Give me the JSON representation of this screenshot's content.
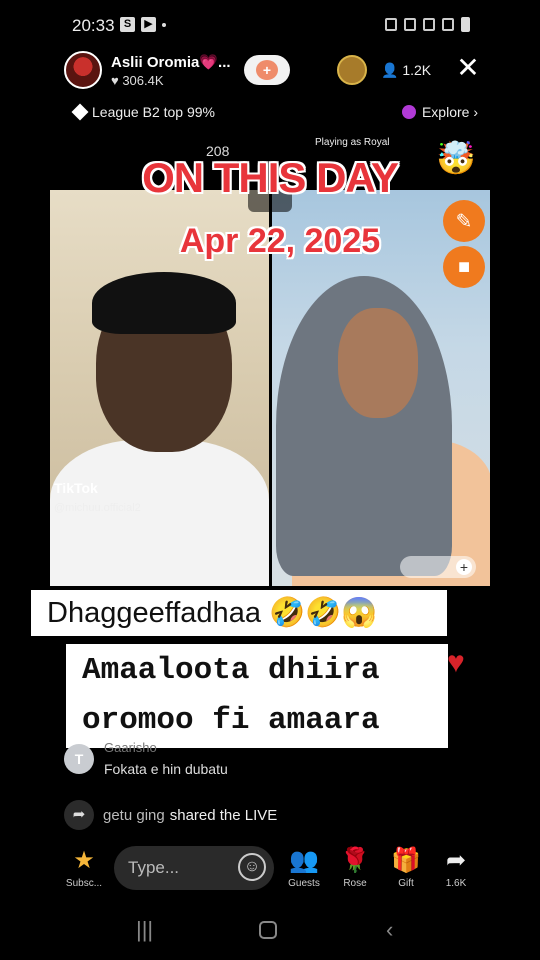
{
  "status_bar": {
    "time": "20:33",
    "s_badge": "S"
  },
  "live_header": {
    "host_name": "Aslii Oromia💗...",
    "host_likes": "♥ 306.4K",
    "follow_symbol": "+",
    "viewer_count": "👤 1.2K",
    "close_symbol": "✕"
  },
  "league": {
    "label": "League B2 top 99%"
  },
  "explore": {
    "label": "Explore ›"
  },
  "battle": {
    "score": "208",
    "playing_label": "Playing as Royal",
    "royal_emoji": "🤯"
  },
  "overlay": {
    "title": "ON THIS DAY",
    "date": "Apr 22, 2025"
  },
  "video": {
    "watermark": "TikTok",
    "watermark_user": "@michuu.official2"
  },
  "captions": {
    "line1": "Dhaggeeffadhaa 🤣🤣😱",
    "line2": "Amaaloota dhiira\noromoo fi amaara",
    "heart": "♥"
  },
  "comments": [
    {
      "avatar_letter": "T",
      "user": "Gaarisho",
      "text": "Fokata e hin dubatu"
    }
  ],
  "share_event": {
    "user": "getu ging",
    "action": "shared the LIVE"
  },
  "toolbar": {
    "subscribe_label": "Subsc...",
    "type_placeholder": "Type...",
    "guests_label": "Guests",
    "rose_label": "Rose",
    "gift_label": "Gift",
    "share_label": "1.6K"
  },
  "colors": {
    "accent_red": "#e8353b",
    "button_orange": "#f07a1e",
    "caption_bg": "#ffffff"
  },
  "icons": [
    "star-icon",
    "emoji-icon",
    "guests-icon",
    "rose-icon",
    "gift-icon",
    "share-arrow-icon",
    "brush-icon",
    "camera-icon"
  ]
}
